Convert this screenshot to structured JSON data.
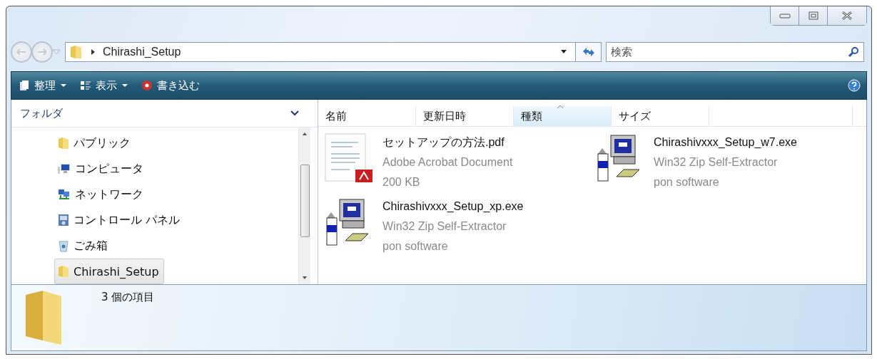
{
  "address": {
    "path": "Chirashi_Setup"
  },
  "search": {
    "placeholder": "検索"
  },
  "toolbar": [
    {
      "label": "整理",
      "kind": "organize",
      "dropdown": true
    },
    {
      "label": "表示",
      "kind": "view",
      "dropdown": true
    },
    {
      "label": "書き込む",
      "kind": "burn",
      "dropdown": false
    }
  ],
  "folders": {
    "title": "フォルダ",
    "items": [
      {
        "label": "パブリック",
        "kind": "folder",
        "selected": false
      },
      {
        "label": "コンピュータ",
        "kind": "computer",
        "selected": false
      },
      {
        "label": "ネットワーク",
        "kind": "network",
        "selected": false
      },
      {
        "label": "コントロール パネル",
        "kind": "control",
        "selected": false
      },
      {
        "label": "ごみ箱",
        "kind": "trash",
        "selected": false
      },
      {
        "label": "Chirashi_Setup",
        "kind": "folder",
        "selected": true
      }
    ]
  },
  "columns": [
    {
      "label": "名前",
      "sorted": false
    },
    {
      "label": "更新日時",
      "sorted": false
    },
    {
      "label": "種類",
      "sorted": true
    },
    {
      "label": "サイズ",
      "sorted": false
    }
  ],
  "files": [
    {
      "name": "セットアップの方法.pdf",
      "kind": "pdf",
      "type": "Adobe Acrobat Document",
      "info": "200 KB"
    },
    {
      "name": "Chirashivxxx_Setup_w7.exe",
      "kind": "exe",
      "type": "Win32 Zip Self-Extractor",
      "info": "pon software"
    },
    {
      "name": "Chirashivxxx_Setup_xp.exe",
      "kind": "exe",
      "type": "Win32 Zip Self-Extractor",
      "info": "pon software"
    }
  ],
  "status_bar": {
    "count": "3 個の項目"
  }
}
